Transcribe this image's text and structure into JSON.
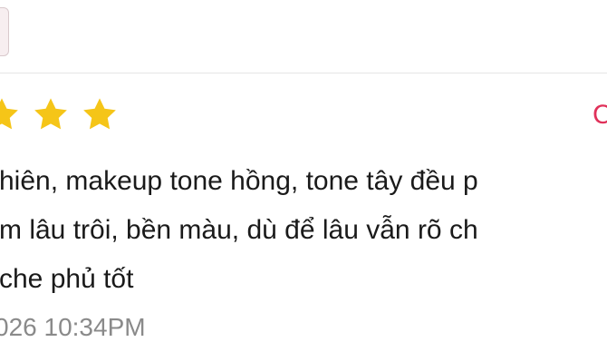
{
  "review": {
    "rating_icon": "star-icon",
    "visible_stars": 2,
    "star_color": "#F5C518",
    "action_label": "C",
    "action_color": "#E0315A",
    "text_lines": [
      "hiên, makeup tone hồng, tone tây đều p",
      "m lâu trôi, bền màu, dù để lâu vẫn rõ ch",
      "che phủ tốt"
    ],
    "date": "026 10:34PM"
  }
}
